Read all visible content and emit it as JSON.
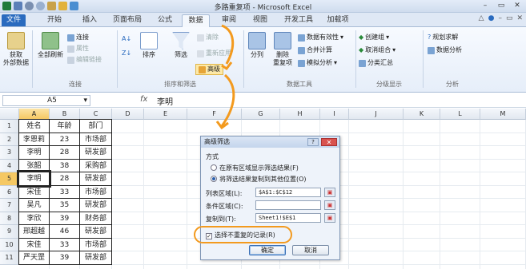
{
  "window": {
    "title": "多路重复项 - Microsoft Excel"
  },
  "tabs": [
    {
      "label": "文件",
      "state": "file"
    },
    {
      "label": "开始"
    },
    {
      "label": "插入"
    },
    {
      "label": "页面布局"
    },
    {
      "label": "公式"
    },
    {
      "label": "数据",
      "state": "active"
    },
    {
      "label": "审阅"
    },
    {
      "label": "视图"
    },
    {
      "label": "开发工具"
    },
    {
      "label": "加载项"
    }
  ],
  "ribbon": {
    "get_external": "获取\n外部数据",
    "refresh_all": "全部刷新",
    "connections": "连接",
    "properties": "属性",
    "edit_links": "编辑链接",
    "group_connections": "连接",
    "sort": "排序",
    "filter": "筛选",
    "clear": "清除",
    "reapply": "重新应用",
    "advanced": "高级",
    "group_sort_filter": "排序和筛选",
    "text_to_columns": "分列",
    "remove_duplicates": "删除\n重复项",
    "data_validation": "数据有效性",
    "consolidate": "合并计算",
    "what_if": "模拟分析",
    "group_data_tools": "数据工具",
    "group": "创建组",
    "ungroup": "取消组合",
    "subtotal": "分类汇总",
    "group_outline": "分级显示",
    "solver": "规划求解",
    "analysis": "数据分析",
    "group_analysis": "分析"
  },
  "formula_bar": {
    "name_box": "A5",
    "fx": "fx",
    "value": "李明"
  },
  "columns": [
    "A",
    "B",
    "C",
    "D",
    "E",
    "F",
    "G",
    "H",
    "I",
    "J",
    "K",
    "L",
    "M"
  ],
  "rows": [
    {
      "n": "1",
      "a": "姓名",
      "b": "年龄",
      "c": "部门"
    },
    {
      "n": "2",
      "a": "李恩莉",
      "b": "23",
      "c": "市场部"
    },
    {
      "n": "3",
      "a": "李明",
      "b": "28",
      "c": "研发部"
    },
    {
      "n": "4",
      "a": "张韶",
      "b": "38",
      "c": "采购部"
    },
    {
      "n": "5",
      "a": "李明",
      "b": "28",
      "c": "研发部"
    },
    {
      "n": "6",
      "a": "宋佳",
      "b": "33",
      "c": "市场部"
    },
    {
      "n": "7",
      "a": "吴凡",
      "b": "35",
      "c": "研发部"
    },
    {
      "n": "8",
      "a": "李欣",
      "b": "39",
      "c": "财务部"
    },
    {
      "n": "9",
      "a": "邢超越",
      "b": "46",
      "c": "研发部"
    },
    {
      "n": "10",
      "a": "宋佳",
      "b": "33",
      "c": "市场部"
    },
    {
      "n": "11",
      "a": "严天罡",
      "b": "39",
      "c": "研发部"
    }
  ],
  "dialog": {
    "title": "高级筛选",
    "method_label": "方式",
    "option1": "在原有区域显示筛选结果(F)",
    "option2": "将筛选结果复制到其他位置(O)",
    "list_range_label": "列表区域(L):",
    "list_range_value": "$A$1:$C$12",
    "criteria_label": "条件区域(C):",
    "criteria_value": "",
    "copy_to_label": "复制到(T):",
    "copy_to_value": "Sheet1!$E$1",
    "unique_label": "选择不重复的记录(R)",
    "ok": "确定",
    "cancel": "取消"
  },
  "colors": {
    "accent": "#f39a1e",
    "file_tab": "#2a6bbf"
  }
}
